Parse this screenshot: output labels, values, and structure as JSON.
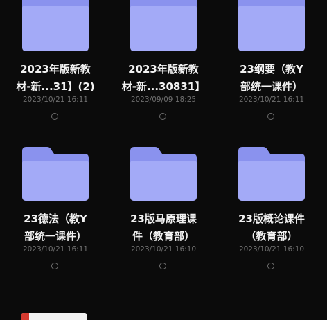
{
  "files": [
    {
      "name_line1": "2023年版新教",
      "name_line2": "材-新...31】(2)",
      "date": "2023/10/21 16:11"
    },
    {
      "name_line1": "2023年版新教",
      "name_line2": "材-新...30831】",
      "date": "2023/09/09 18:25"
    },
    {
      "name_line1": "23纲要（教Y",
      "name_line2": "部统一课件）",
      "date": "2023/10/21 16:11"
    },
    {
      "name_line1": "23德法（教Y",
      "name_line2": "部统一课件）",
      "date": "2023/10/21 16:11"
    },
    {
      "name_line1": "23版马原理课",
      "name_line2": "件（教育部）",
      "date": "2023/10/21 16:10"
    },
    {
      "name_line1": "23版概论课件",
      "name_line2": "（教育部）",
      "date": "2023/10/21 16:10"
    }
  ],
  "colors": {
    "background": "#0b0b0b",
    "folder_back": "#8a92ee",
    "folder_front": "#a3aaf7",
    "name_text": "#f2f2f2",
    "date_text": "#6f6f6f",
    "radio_border": "#6d6d6d"
  },
  "icons": {
    "folder": "folder-icon",
    "selection": "radio-unchecked-icon",
    "document": "pdf-document-icon"
  }
}
